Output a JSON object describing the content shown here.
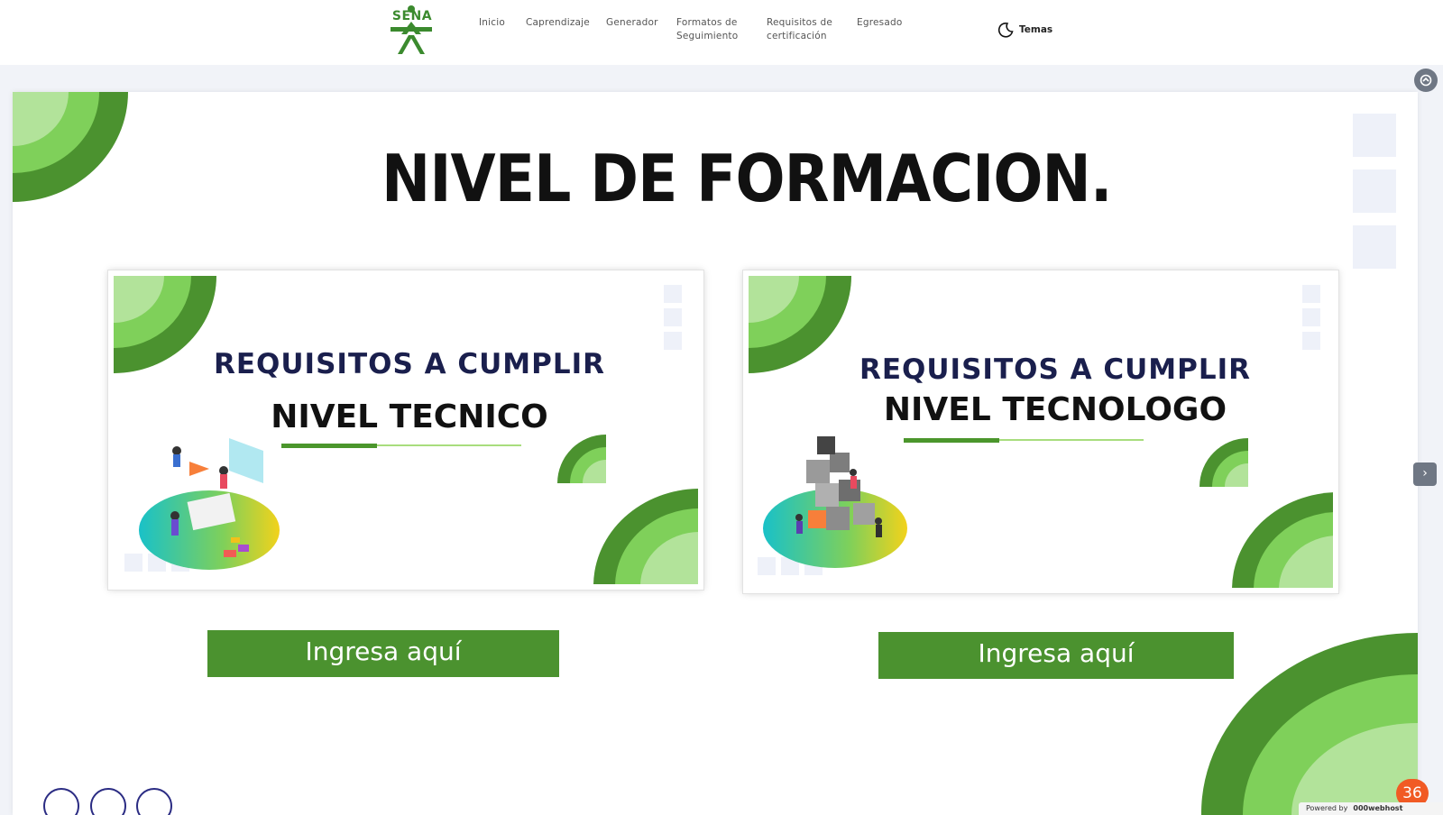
{
  "navbar": {
    "logo_text": "SENA",
    "items": [
      {
        "label": "Inicio"
      },
      {
        "label": "Caprendizaje"
      },
      {
        "label": "Generador"
      },
      {
        "label": "Formatos de Seguimiento"
      },
      {
        "label": "Requisitos de certificación"
      },
      {
        "label": "Egresado"
      }
    ],
    "theme_label": "Temas",
    "theme_icon": "moon-icon"
  },
  "slide": {
    "title": "NIVEL DE FORMACION.",
    "cards": [
      {
        "line1": "REQUISITOS A CUMPLIR",
        "line2": "NIVEL TECNICO",
        "button": "Ingresa aquí"
      },
      {
        "line1": "REQUISITOS A CUMPLIR",
        "line2": "NIVEL TECNOLOGO",
        "button": "Ingresa aquí"
      }
    ]
  },
  "controls": {
    "next_label": "›",
    "badge": "36",
    "powered_prefix": "Powered by",
    "powered_brand": "000webhost"
  },
  "colors": {
    "brand_green": "#4b922f",
    "light_green": "#7fd05a",
    "pale_green": "#b2e39a",
    "title_navy": "#1a1f4d",
    "badge_orange": "#f15a24"
  }
}
